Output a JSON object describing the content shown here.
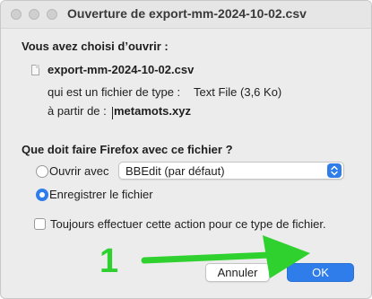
{
  "window": {
    "title": "Ouverture de export-mm-2024-10-02.csv"
  },
  "dialog": {
    "intro": "Vous avez choisi d’ouvrir :",
    "file_name": "export-mm-2024-10-02.csv",
    "type_label": "qui est un fichier de type :",
    "type_value": "Text File (3,6 Ko)",
    "from_label": "à partir de :",
    "from_value": "metamots.xyz",
    "question": "Que doit faire Firefox avec ce fichier ?",
    "open_with_label": "Ouvrir avec",
    "open_with_app": "BBEdit (par défaut)",
    "save_label": "Enregistrer le fichier",
    "always_label": "Toujours effectuer cette action pour ce type de fichier.",
    "cancel_label": "Annuler",
    "ok_label": "OK"
  },
  "annotation": {
    "number": "1",
    "color": "#2fd12f"
  },
  "colors": {
    "accent": "#2f7dea",
    "window_bg": "#ececec"
  }
}
